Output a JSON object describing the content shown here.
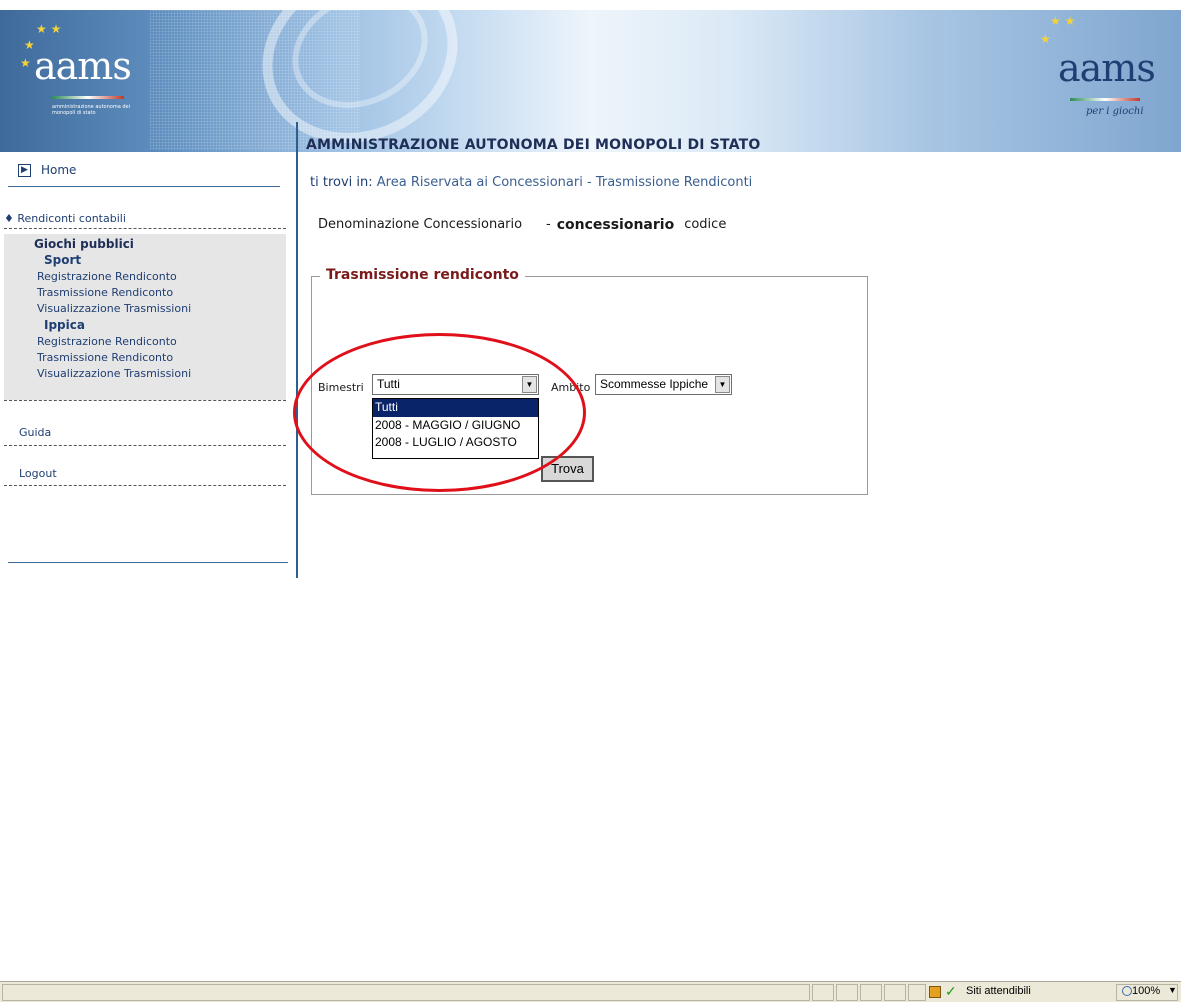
{
  "banner": {
    "logo_left": {
      "word": "aams",
      "subtitle": "amministrazione autonoma dei monopoli di stato"
    },
    "logo_right": {
      "word": "aams",
      "tagline": "per i giochi"
    }
  },
  "sidebar": {
    "home_label": "Home",
    "group_title": "Rendiconti contabili",
    "section_title": "Giochi pubblici",
    "sport": {
      "title": "Sport",
      "links": [
        "Registrazione Rendiconto",
        "Trasmissione Rendiconto",
        "Visualizzazione Trasmissioni"
      ]
    },
    "ippica": {
      "title": "Ippica",
      "links": [
        "Registrazione Rendiconto",
        "Trasmissione Rendiconto",
        "Visualizzazione Trasmissioni"
      ]
    },
    "guida_label": "Guida",
    "logout_label": "Logout"
  },
  "main": {
    "title": "AMMINISTRAZIONE AUTONOMA DEI MONOPOLI DI STATO",
    "breadcrumb_prefix": "ti trovi in:",
    "breadcrumb_area": "Area Riservata ai Concessionari",
    "breadcrumb_sep": "-",
    "breadcrumb_page": "Trasmissione Rendiconti",
    "conc_label": "Denominazione Concessionario",
    "conc_sep": "-",
    "conc_value": "concessionario",
    "conc_code": "codice",
    "form": {
      "legend": "Trasmissione rendiconto",
      "bimestri_label": "Bimestri",
      "bimestri_value": "Tutti",
      "bimestri_options": [
        "Tutti",
        "2008 - MAGGIO / GIUGNO",
        "2008 - LUGLIO / AGOSTO"
      ],
      "ambito_label": "Ambito",
      "ambito_value": "Scommesse Ippiche",
      "submit_label": "Trova"
    }
  },
  "statusbar": {
    "zone": "Siti attendibili",
    "zoom": "100%"
  },
  "colors": {
    "accent_red": "#e0101a",
    "nav_blue": "#1f3e72",
    "legend_red": "#7a1a1a",
    "selected_option": "#0a246a"
  }
}
